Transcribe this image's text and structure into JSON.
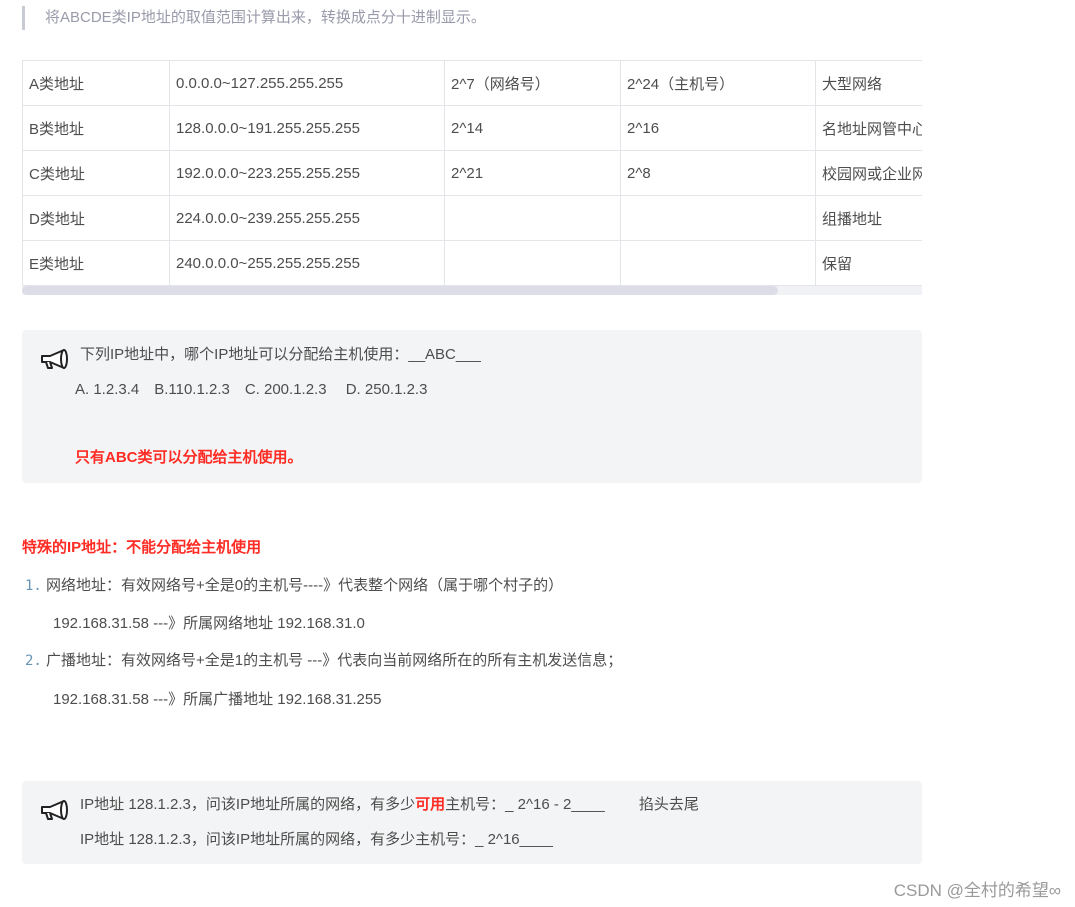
{
  "intro": "将ABCDE类IP地址的取值范围计算出来，转换成点分十进制显示。",
  "table_rows": [
    [
      "A类地址",
      "0.0.0.0~127.255.255.255",
      "2^7（网络号）",
      "2^24（主机号）",
      "大型网络"
    ],
    [
      "B类地址",
      "128.0.0.0~191.255.255.255",
      "2^14",
      "2^16",
      "名地址网管中心"
    ],
    [
      "C类地址",
      "192.0.0.0~223.255.255.255",
      "2^21",
      "2^8",
      "校园网或企业网"
    ],
    [
      "D类地址",
      "224.0.0.0~239.255.255.255",
      "",
      "",
      "组播地址"
    ],
    [
      "E类地址",
      "240.0.0.0~255.255.255.255",
      "",
      "",
      "保留"
    ]
  ],
  "note1": {
    "question": "下列IP地址中，哪个IP地址可以分配给主机使用：__ABC___",
    "options": "A. 1.2.3.4　B.110.1.2.3　C. 200.1.2.3　 D. 250.1.2.3",
    "answer": "只有ABC类可以分配给主机使用。"
  },
  "special": {
    "heading": "特殊的IP地址：不能分配给主机使用",
    "items": [
      {
        "num": "1.",
        "text": "网络地址：有效网络号+全是0的主机号----》代表整个网络（属于哪个村子的）",
        "example": "192.168.31.58 ---》所属网络地址 192.168.31.0"
      },
      {
        "num": "2.",
        "text": "广播地址：有效网络号+全是1的主机号 ---》代表向当前网络所在的所有主机发送信息；",
        "example": "192.168.31.58 ---》所属广播地址 192.168.31.255"
      }
    ]
  },
  "note2": {
    "line1_pre": "IP地址 128.1.2.3，问该IP地址所属的网络，有多少",
    "line1_highlight": "可用",
    "line1_post": "主机号：_ 2^16 - 2____　　 掐头去尾",
    "line2": "IP地址 128.1.2.3，问该IP地址所属的网络，有多少主机号：_ 2^16____"
  },
  "watermark": "CSDN @全村的希望∞",
  "colors": {
    "accent_red": "#fe2c24",
    "list_number": "#6795b5",
    "note_bg": "#f3f4f5"
  },
  "icons": [
    "megaphone-icon"
  ]
}
